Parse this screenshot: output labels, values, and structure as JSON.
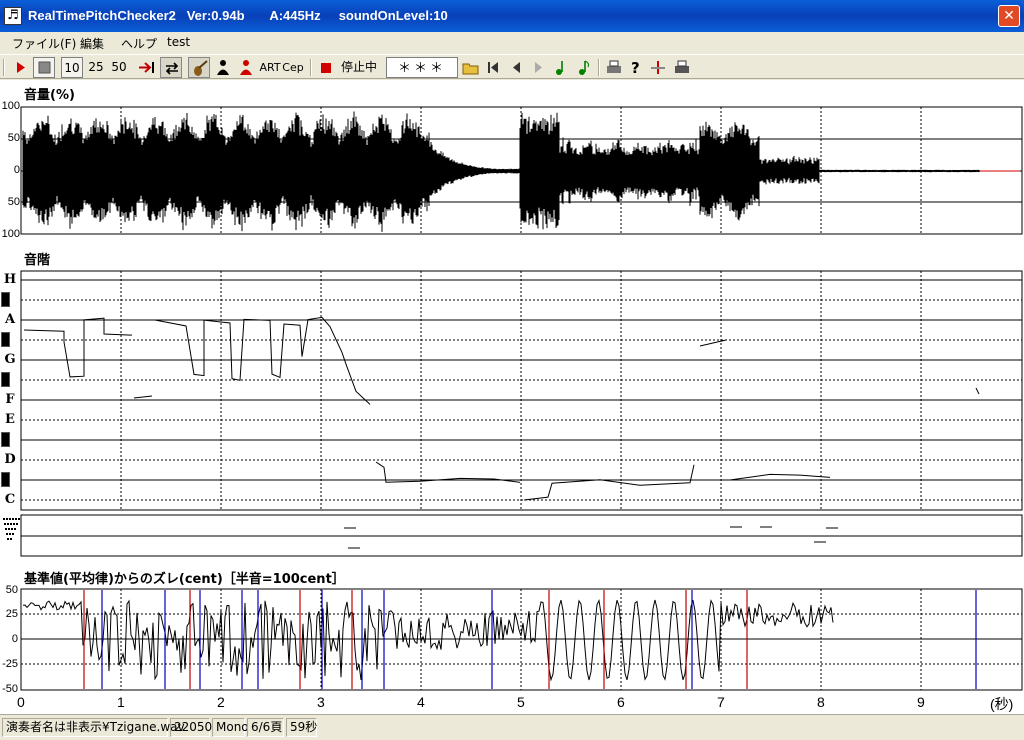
{
  "window": {
    "title": "RealTimePitchChecker2   Ver:0.94b       A:445Hz     soundOnLevel:10",
    "icon_glyph": "♬",
    "close_glyph": "✕"
  },
  "menu": [
    "ファイル(F)",
    "編集",
    "ヘルプ",
    "test"
  ],
  "toolbar": {
    "speed_10": "10",
    "speed_25": "25",
    "speed_50": "50",
    "art_label": "ART",
    "cep_label": "Cep",
    "stop_label": "停止中",
    "status_display": "＊＊＊"
  },
  "volume_panel": {
    "title": "音量(%)",
    "y_labels": [
      "100",
      "50",
      "0",
      "50",
      "100"
    ]
  },
  "scale_panel": {
    "title": "音階",
    "notes": [
      "H",
      "A",
      "G",
      "F",
      "E",
      "D",
      "C"
    ]
  },
  "cent_panel": {
    "title": "基準値(平均律)からのズレ(cent)［半音=100cent］",
    "y_labels": [
      "50",
      "25",
      "0",
      "-25",
      "-50"
    ]
  },
  "time_axis": {
    "ticks": [
      "0",
      "1",
      "2",
      "3",
      "4",
      "5",
      "6",
      "7",
      "8",
      "9"
    ],
    "unit": "(秒)"
  },
  "statusbar": {
    "file": "演奏者名は非表示¥Tzigane.wav",
    "rate": "22050",
    "channels": "Mono",
    "page": "6/6頁",
    "duration": "59秒"
  },
  "colors": {
    "titlebar": "#0a5fd8",
    "cent_red": "#c00000",
    "cent_blue": "#0000c0",
    "trace": "#000000"
  }
}
